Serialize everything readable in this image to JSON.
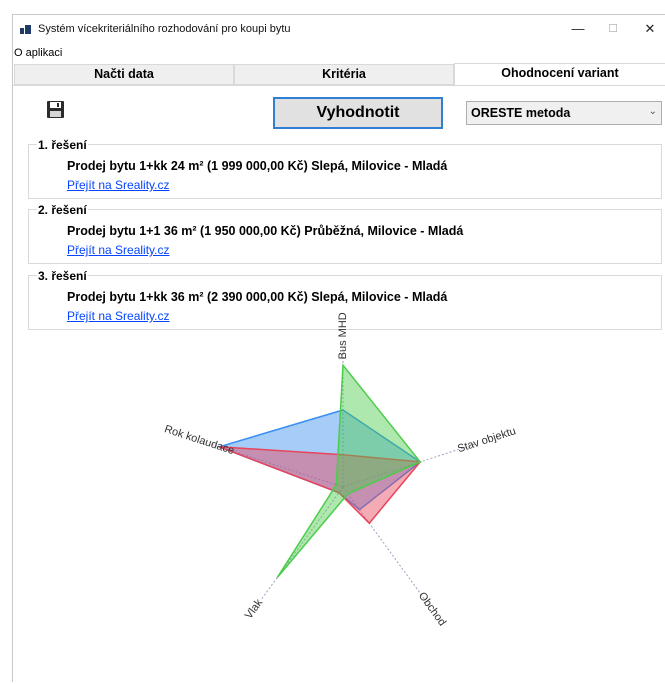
{
  "window": {
    "title": "Systém vícekriteriálního rozhodování pro koupi bytu",
    "minimize": "—",
    "maximize": "☐",
    "close": "✕"
  },
  "menu": {
    "about": "O aplikaci"
  },
  "tabs": [
    {
      "label": "Načti data",
      "active": false
    },
    {
      "label": "Kritéria",
      "active": false
    },
    {
      "label": "Ohodnocení variant",
      "active": true
    }
  ],
  "toolbar": {
    "save_icon": "floppy-disk-icon",
    "evaluate_label": "Vyhodnotit",
    "method_selected": "ORESTE metoda"
  },
  "results": [
    {
      "title": "1. řešení",
      "name": "Prodej bytu 1+kk 24 m² (1 999 000,00 Kč) Slepá, Milovice - Mladá",
      "link": "Přejít na Sreality.cz"
    },
    {
      "title": "2. řešení",
      "name": "Prodej bytu 1+1 36 m² (1 950 000,00 Kč) Průběžná, Milovice - Mladá",
      "link": "Přejít na Sreality.cz"
    },
    {
      "title": "3. řešení",
      "name": "Prodej bytu 1+kk 36 m² (2 390 000,00 Kč) Slepá, Milovice - Mladá",
      "link": "Přejít na Sreality.cz"
    }
  ],
  "chart_data": {
    "type": "radar",
    "axes": [
      "Bus MHD",
      "Stav objektu",
      "Obchod",
      "Vlak",
      "Rok kolaudace"
    ],
    "series": [
      {
        "values": [
          0.55,
          0.58,
          0.2,
          0.05,
          0.93
        ],
        "color": "#3a8ff0"
      },
      {
        "values": [
          0.23,
          0.58,
          0.32,
          0.05,
          0.93
        ],
        "color": "#e8455a"
      },
      {
        "values": [
          0.87,
          0.58,
          0.06,
          0.8,
          0.05
        ],
        "color": "#4ccc4c"
      }
    ],
    "colors": {
      "axis": "#9aa6c0",
      "label": "#333333"
    }
  }
}
